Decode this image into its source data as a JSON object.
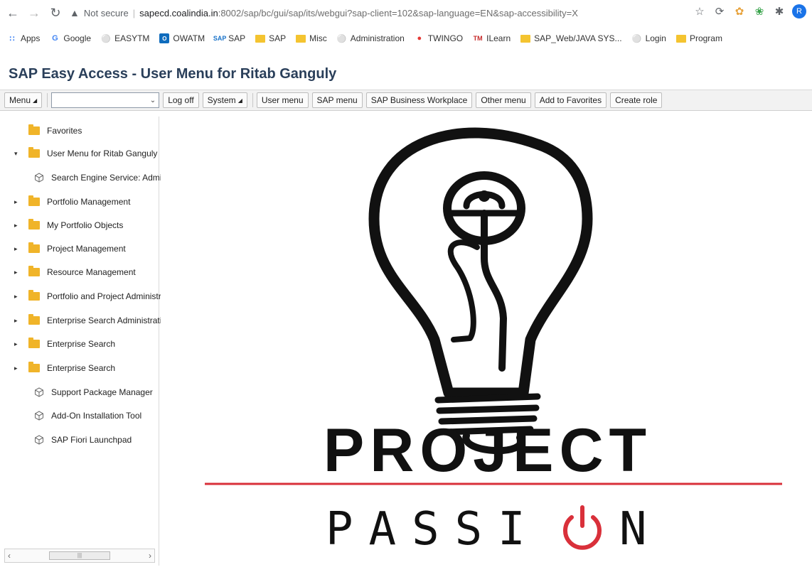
{
  "browser": {
    "not_secure": "Not secure",
    "url_host": "sapecd.coalindia.in",
    "url_rest": ":8002/sap/bc/gui/sap/its/webgui?sap-client=102&sap-language=EN&sap-accessibility=X",
    "profile_initial": "R",
    "bookmarks": [
      {
        "label": "Apps",
        "icon": "apps-grid-icon"
      },
      {
        "label": "Google",
        "icon": "google-icon"
      },
      {
        "label": "EASYTM",
        "icon": "globe-icon"
      },
      {
        "label": "OWATM",
        "icon": "outlook-icon"
      },
      {
        "label": "SAP",
        "icon": "sap-icon"
      },
      {
        "label": "SAP",
        "icon": "folder-icon"
      },
      {
        "label": "Misc",
        "icon": "folder-icon"
      },
      {
        "label": "Administration",
        "icon": "globe-icon"
      },
      {
        "label": "TWINGO",
        "icon": "twingo-icon"
      },
      {
        "label": "ILearn",
        "icon": "tm-icon"
      },
      {
        "label": "SAP_Web/JAVA SYS...",
        "icon": "folder-icon"
      },
      {
        "label": "Login",
        "icon": "globe-icon"
      },
      {
        "label": "Program",
        "icon": "folder-icon"
      }
    ]
  },
  "sap": {
    "title": "SAP Easy Access  -  User Menu for Ritab Ganguly",
    "toolbar": {
      "menu": "Menu",
      "command_value": "",
      "log_off": "Log off",
      "system": "System",
      "user_menu": "User menu",
      "sap_menu": "SAP menu",
      "business_workplace": "SAP Business Workplace",
      "other_menu": "Other menu",
      "add_favorites": "Add to Favorites",
      "create_role": "Create role"
    },
    "tree": [
      {
        "label": "Favorites",
        "type": "folder",
        "expand": ""
      },
      {
        "label": "User Menu for Ritab Ganguly",
        "type": "folder",
        "expand": "▾"
      },
      {
        "label": "Search Engine Service: Admin",
        "type": "txn",
        "expand": ""
      },
      {
        "label": "Portfolio Management",
        "type": "folder",
        "expand": "▸"
      },
      {
        "label": "My Portfolio Objects",
        "type": "folder",
        "expand": "▸"
      },
      {
        "label": "Project Management",
        "type": "folder",
        "expand": "▸"
      },
      {
        "label": "Resource Management",
        "type": "folder",
        "expand": "▸"
      },
      {
        "label": "Portfolio and Project Administrat",
        "type": "folder",
        "expand": "▸"
      },
      {
        "label": "Enterprise Search Administration",
        "type": "folder",
        "expand": "▸"
      },
      {
        "label": "Enterprise Search",
        "type": "folder",
        "expand": "▸"
      },
      {
        "label": "Enterprise Search",
        "type": "folder",
        "expand": "▸"
      },
      {
        "label": "Support Package Manager",
        "type": "txn",
        "expand": ""
      },
      {
        "label": "Add-On Installation Tool",
        "type": "txn",
        "expand": ""
      },
      {
        "label": "SAP Fiori Launchpad",
        "type": "txn",
        "expand": ""
      }
    ]
  },
  "splash": {
    "word1": "PROJECT",
    "word2_pre": "PASSI",
    "word2_post": "N",
    "accent_color": "#d9303a"
  }
}
